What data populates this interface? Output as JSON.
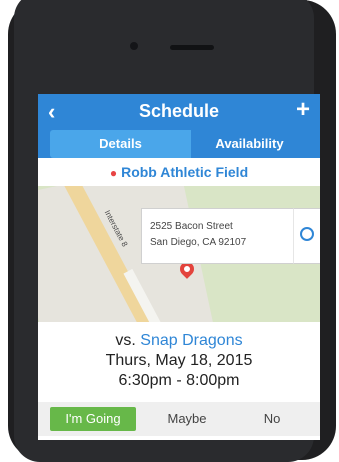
{
  "header": {
    "back_icon": "chevron-left-icon",
    "title": "Schedule",
    "add_icon": "plus-icon"
  },
  "tabs": [
    {
      "label": "Details",
      "selected": true
    },
    {
      "label": "Availability",
      "selected": false
    }
  ],
  "location": {
    "name": "Robb Athletic Field",
    "pin_color": "#e84444"
  },
  "map": {
    "street_label": "Interstate 8",
    "address_line1": "2525 Bacon Street",
    "address_line2": "San Diego, CA 92107",
    "directions_icon": "navigation-icon"
  },
  "event": {
    "vs_prefix": "vs.",
    "opponent": "Snap Dragons",
    "date": "Thurs, May 18, 2015",
    "time": "6:30pm - 8:00pm"
  },
  "rsvp": {
    "going": "I'm Going",
    "maybe": "Maybe",
    "no": "No",
    "selected": "going"
  },
  "colors": {
    "accent": "#2f86d6",
    "going_green": "#67b849"
  }
}
